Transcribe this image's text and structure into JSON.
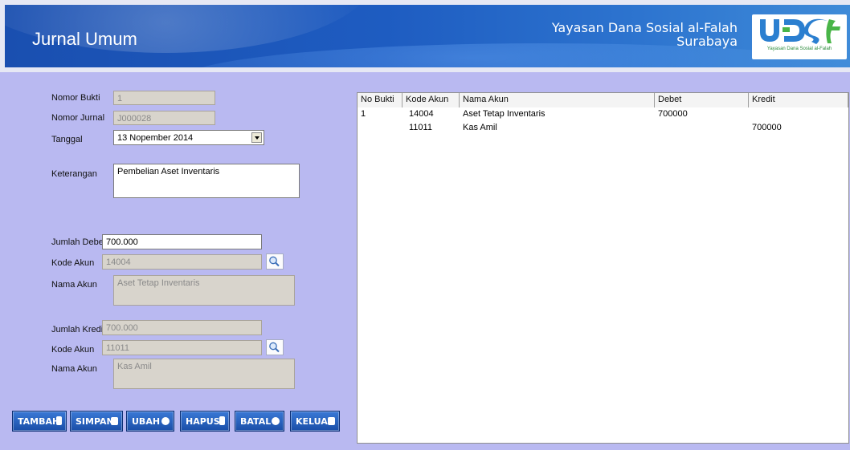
{
  "header": {
    "title": "Jurnal Umum",
    "org_name": "Yayasan Dana Sosial al-Falah",
    "org_city": "Surabaya",
    "logo_text": "UDSF",
    "logo_caption": "Yayasan Dana Sosial al-Falah"
  },
  "form": {
    "nomor_bukti": {
      "label": "Nomor Bukti",
      "value": "1"
    },
    "nomor_jurnal": {
      "label": "Nomor Jurnal",
      "value": "J000028"
    },
    "tanggal": {
      "label": "Tanggal",
      "value": "13 Nopember 2014"
    },
    "keterangan": {
      "label": "Keterangan",
      "value": "Pembelian Aset Inventaris"
    },
    "jumlah_debet": {
      "label": "Jumlah Debet",
      "value": "700.000"
    },
    "kode_akun_debet": {
      "label": "Kode Akun",
      "value": "14004"
    },
    "nama_akun_debet": {
      "label": "Nama Akun",
      "value": "Aset Tetap Inventaris"
    },
    "jumlah_kredit": {
      "label": "Jumlah Kredit",
      "value": "700.000"
    },
    "kode_akun_kredit": {
      "label": "Kode Akun",
      "value": "11011"
    },
    "nama_akun_kredit": {
      "label": "Nama Akun",
      "value": "Kas Amil"
    }
  },
  "buttons": {
    "tambah": "TAMBAH",
    "simpan": "SIMPAN",
    "ubah": "UBAH",
    "hapus": "HAPUS",
    "batal": "BATAL",
    "keluar": "KELUAR"
  },
  "grid": {
    "columns": [
      "No Bukti",
      "Kode Akun",
      "Nama Akun",
      "Debet",
      "Kredit"
    ],
    "rows": [
      [
        "1",
        "14004",
        "Aset Tetap Inventaris",
        "700000",
        ""
      ],
      [
        "",
        "11011",
        "Kas Amil",
        "",
        "700000"
      ]
    ]
  },
  "colors": {
    "background": "#b9b9f1",
    "banner": "#1e5cc1",
    "button": "#1a4ea7"
  }
}
